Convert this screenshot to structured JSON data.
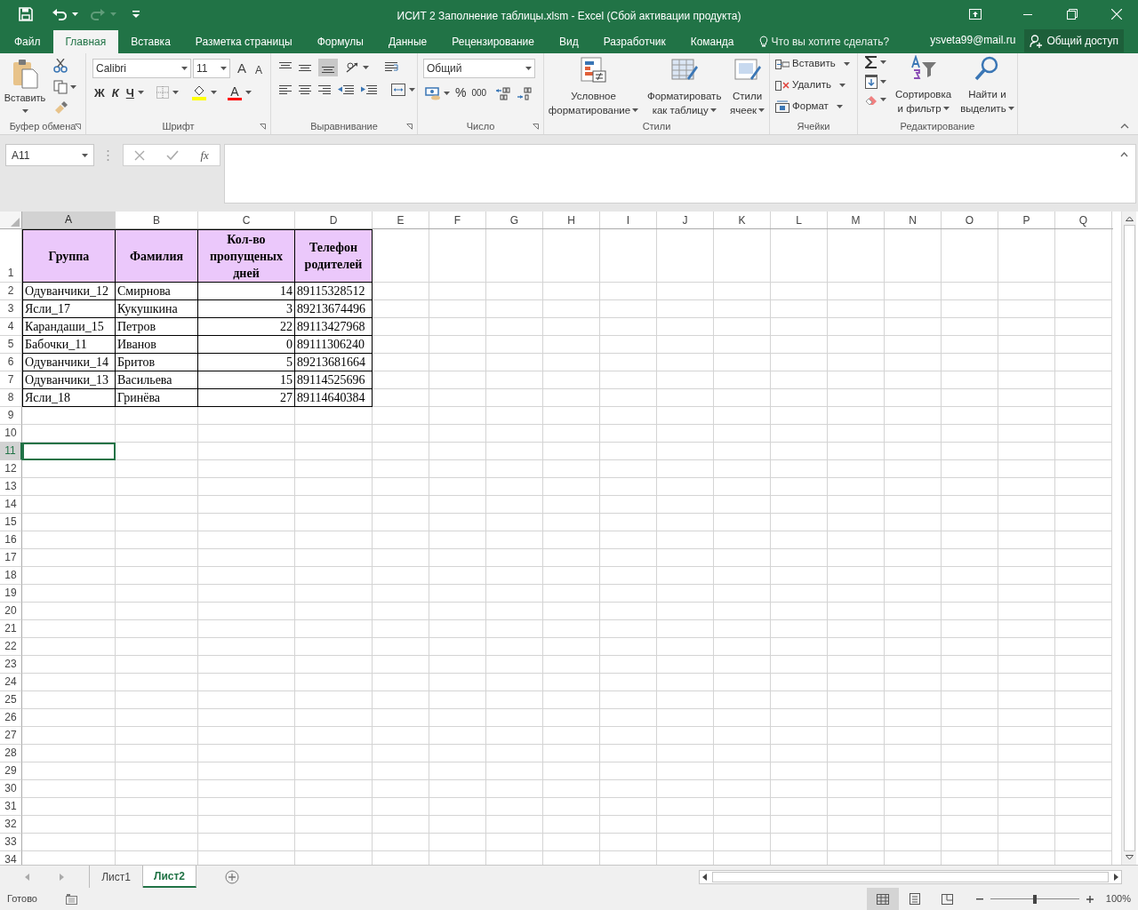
{
  "window": {
    "title": "ИСИТ 2 Заполнение таблицы.xlsm - Excel (Сбой активации продукта)"
  },
  "ribbon_tabs": [
    {
      "label": "Файл",
      "selected": false
    },
    {
      "label": "Главная",
      "selected": true
    },
    {
      "label": "Вставка",
      "selected": false
    },
    {
      "label": "Разметка страницы",
      "selected": false
    },
    {
      "label": "Формулы",
      "selected": false
    },
    {
      "label": "Данные",
      "selected": false
    },
    {
      "label": "Рецензирование",
      "selected": false
    },
    {
      "label": "Вид",
      "selected": false
    },
    {
      "label": "Разработчик",
      "selected": false
    },
    {
      "label": "Команда",
      "selected": false
    }
  ],
  "tell_me": {
    "placeholder": "Что вы хотите сделать?"
  },
  "account": "ysveta99@mail.ru",
  "share_button": "Общий доступ",
  "clipboard": {
    "paste": "Вставить",
    "label": "Буфер обмена"
  },
  "font": {
    "name": "Calibri",
    "size": "11",
    "grow": "A",
    "shrink": "A",
    "bold": "Ж",
    "italic": "К",
    "underline": "Ч",
    "tint_glyph": "A",
    "label": "Шрифт"
  },
  "alignment": {
    "label": "Выравнивание"
  },
  "number": {
    "format": "Общий",
    "percent": "%",
    "thousands": "000",
    "label": "Число"
  },
  "styles": {
    "buttons": [
      {
        "lines": [
          "Условное",
          "форматирование"
        ]
      },
      {
        "lines": [
          "Форматировать",
          "как таблицу"
        ]
      },
      {
        "lines": [
          "Стили",
          "ячеек"
        ]
      }
    ],
    "label": "Стили"
  },
  "cells_group": {
    "buttons": [
      "Вставить",
      "Удалить",
      "Формат"
    ],
    "label": "Ячейки"
  },
  "editing": {
    "buttons": [
      {
        "lines": [
          "Сортировка",
          "и фильтр"
        ]
      },
      {
        "lines": [
          "Найти и",
          "выделить"
        ]
      }
    ],
    "label": "Редактирование"
  },
  "name_box": "A11",
  "formula_fx": "fx",
  "columns": [
    {
      "label": "A",
      "selected": true
    },
    {
      "label": "B",
      "selected": false
    },
    {
      "label": "C",
      "selected": false
    },
    {
      "label": "D",
      "selected": false
    },
    {
      "label": "E",
      "selected": false
    },
    {
      "label": "F",
      "selected": false
    },
    {
      "label": "G",
      "selected": false
    },
    {
      "label": "H",
      "selected": false
    },
    {
      "label": "I",
      "selected": false
    },
    {
      "label": "J",
      "selected": false
    },
    {
      "label": "K",
      "selected": false
    },
    {
      "label": "L",
      "selected": false
    },
    {
      "label": "M",
      "selected": false
    },
    {
      "label": "N",
      "selected": false
    },
    {
      "label": "O",
      "selected": false
    },
    {
      "label": "P",
      "selected": false
    },
    {
      "label": "Q",
      "selected": false
    }
  ],
  "rows": [
    {
      "label": "1",
      "selected": false
    },
    {
      "label": "2",
      "selected": false
    },
    {
      "label": "3",
      "selected": false
    },
    {
      "label": "4",
      "selected": false
    },
    {
      "label": "5",
      "selected": false
    },
    {
      "label": "6",
      "selected": false
    },
    {
      "label": "7",
      "selected": false
    },
    {
      "label": "8",
      "selected": false
    },
    {
      "label": "9",
      "selected": false
    },
    {
      "label": "10",
      "selected": false
    },
    {
      "label": "11",
      "selected": true
    },
    {
      "label": "12",
      "selected": false
    },
    {
      "label": "13",
      "selected": false
    },
    {
      "label": "14",
      "selected": false
    },
    {
      "label": "15",
      "selected": false
    },
    {
      "label": "16",
      "selected": false
    },
    {
      "label": "17",
      "selected": false
    },
    {
      "label": "18",
      "selected": false
    },
    {
      "label": "19",
      "selected": false
    },
    {
      "label": "20",
      "selected": false
    },
    {
      "label": "21",
      "selected": false
    },
    {
      "label": "22",
      "selected": false
    },
    {
      "label": "23",
      "selected": false
    },
    {
      "label": "24",
      "selected": false
    },
    {
      "label": "25",
      "selected": false
    },
    {
      "label": "26",
      "selected": false
    },
    {
      "label": "27",
      "selected": false
    },
    {
      "label": "28",
      "selected": false
    },
    {
      "label": "29",
      "selected": false
    },
    {
      "label": "30",
      "selected": false
    },
    {
      "label": "31",
      "selected": false
    },
    {
      "label": "32",
      "selected": false
    },
    {
      "label": "33",
      "selected": false
    },
    {
      "label": "34",
      "selected": false
    }
  ],
  "table": {
    "header": [
      "Группа",
      "Фамилия",
      "Кол-во пропущеных дней",
      "Телефон родителей"
    ],
    "rows": [
      [
        "Одуванчики_12",
        "Смирнова",
        "14",
        "89115328512"
      ],
      [
        "Ясли_17",
        "Кукушкина",
        "3",
        "89213674496"
      ],
      [
        "Карандаши_15",
        "Петров",
        "22",
        "89113427968"
      ],
      [
        "Бабочки_11",
        "Иванов",
        "0",
        "89111306240"
      ],
      [
        "Одуванчики_14",
        "Бритов",
        "5",
        "89213681664"
      ],
      [
        "Одуванчики_13",
        "Васильева",
        "15",
        "89114525696"
      ],
      [
        "Ясли_18",
        "Гринёва",
        "27",
        "89114640384"
      ]
    ]
  },
  "sheet_tabs": [
    {
      "label": "Лист1",
      "selected": false
    },
    {
      "label": "Лист2",
      "selected": true
    }
  ],
  "status": "Готово",
  "zoom": {
    "label": "100%",
    "level": 0.5
  }
}
